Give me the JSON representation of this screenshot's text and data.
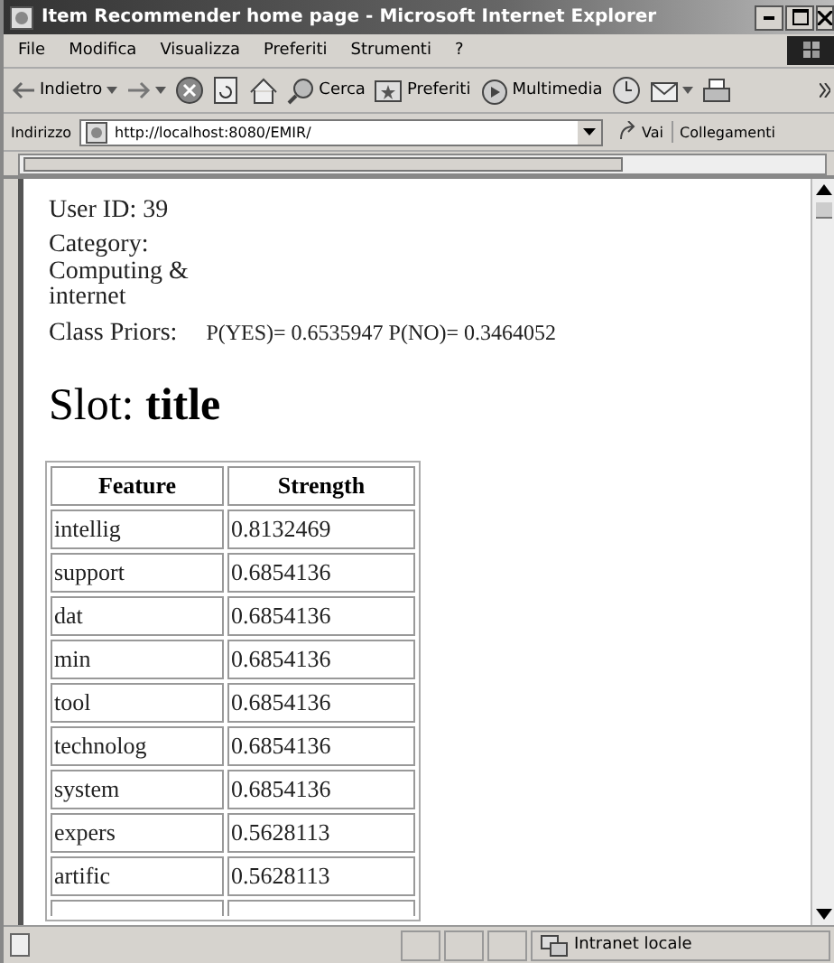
{
  "window": {
    "title": "Item Recommender home page - Microsoft Internet Explorer"
  },
  "menu": [
    "File",
    "Modifica",
    "Visualizza",
    "Preferiti",
    "Strumenti",
    "?"
  ],
  "toolbar": [
    {
      "kind": "back",
      "label": "Indietro"
    },
    {
      "kind": "forward"
    },
    {
      "kind": "stop"
    },
    {
      "kind": "refresh"
    },
    {
      "kind": "home"
    },
    {
      "kind": "search",
      "label": "Cerca"
    },
    {
      "kind": "favorites",
      "label": "Preferiti"
    },
    {
      "kind": "media",
      "label": "Multimedia"
    },
    {
      "kind": "history"
    },
    {
      "kind": "mail"
    },
    {
      "kind": "print"
    }
  ],
  "address_bar": {
    "label": "Indirizzo",
    "url": "http://localhost:8080/EMIR/",
    "go": "Vai",
    "links": "Collegamenti"
  },
  "page": {
    "user_id": "User ID: 39",
    "category": "Category: Computing & internet",
    "priors_label": "Class Priors:",
    "priors_value": "P(YES)= 0.6535947 P(NO)= 0.3464052",
    "slot_heading": "Slot: **title**",
    "table": {
      "columns": [
        "Feature",
        "Strength"
      ],
      "rows": [
        [
          "intellig",
          "0.8132469"
        ],
        [
          "support",
          "0.6854136"
        ],
        [
          "dat",
          "0.6854136"
        ],
        [
          "min",
          "0.6854136"
        ],
        [
          "tool",
          "0.6854136"
        ],
        [
          "technolog",
          "0.6854136"
        ],
        [
          "system",
          "0.6854136"
        ],
        [
          "expers",
          "0.5628113"
        ],
        [
          "artific",
          "0.5628113"
        ]
      ]
    }
  },
  "status_bar": {
    "zone": "Intranet locale"
  }
}
